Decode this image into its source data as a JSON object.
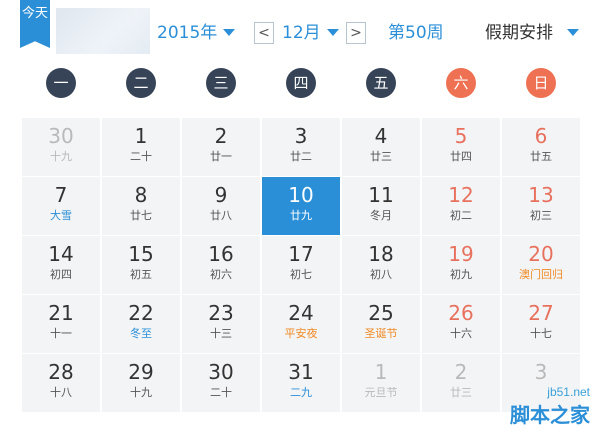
{
  "header": {
    "today_label": "今天",
    "year_label": "2015年",
    "prev_label": "<",
    "month_label": "12月",
    "next_label": ">",
    "week_label": "第50周",
    "holiday_label": "假期安排"
  },
  "weekdays": [
    "一",
    "二",
    "三",
    "四",
    "五",
    "六",
    "日"
  ],
  "weeks": [
    [
      {
        "day": "30",
        "sub": "十九",
        "dim": true
      },
      {
        "day": "1",
        "sub": "二十"
      },
      {
        "day": "2",
        "sub": "廿一"
      },
      {
        "day": "3",
        "sub": "廿二"
      },
      {
        "day": "4",
        "sub": "廿三"
      },
      {
        "day": "5",
        "sub": "廿四",
        "weekend": true
      },
      {
        "day": "6",
        "sub": "廿五",
        "weekend": true
      }
    ],
    [
      {
        "day": "7",
        "sub": "大雪",
        "sub_style": "blue"
      },
      {
        "day": "8",
        "sub": "廿七"
      },
      {
        "day": "9",
        "sub": "廿八"
      },
      {
        "day": "10",
        "sub": "廿九",
        "selected": true
      },
      {
        "day": "11",
        "sub": "冬月"
      },
      {
        "day": "12",
        "sub": "初二",
        "weekend": true
      },
      {
        "day": "13",
        "sub": "初三",
        "weekend": true
      }
    ],
    [
      {
        "day": "14",
        "sub": "初四"
      },
      {
        "day": "15",
        "sub": "初五"
      },
      {
        "day": "16",
        "sub": "初六"
      },
      {
        "day": "17",
        "sub": "初七"
      },
      {
        "day": "18",
        "sub": "初八"
      },
      {
        "day": "19",
        "sub": "初九",
        "weekend": true
      },
      {
        "day": "20",
        "sub": "澳门回归",
        "weekend": true,
        "sub_style": "orange"
      }
    ],
    [
      {
        "day": "21",
        "sub": "十一"
      },
      {
        "day": "22",
        "sub": "冬至",
        "sub_style": "blue"
      },
      {
        "day": "23",
        "sub": "十三"
      },
      {
        "day": "24",
        "sub": "平安夜",
        "sub_style": "orange"
      },
      {
        "day": "25",
        "sub": "圣诞节",
        "sub_style": "orange"
      },
      {
        "day": "26",
        "sub": "十六",
        "weekend": true
      },
      {
        "day": "27",
        "sub": "十七",
        "weekend": true
      }
    ],
    [
      {
        "day": "28",
        "sub": "十八"
      },
      {
        "day": "29",
        "sub": "十九"
      },
      {
        "day": "30",
        "sub": "二十"
      },
      {
        "day": "31",
        "sub": "二九",
        "sub_style": "blue"
      },
      {
        "day": "1",
        "sub": "元旦节",
        "dim": true
      },
      {
        "day": "2",
        "sub": "廿三",
        "dim": true
      },
      {
        "day": "3",
        "sub": "",
        "dim": true
      }
    ]
  ],
  "watermark": {
    "url": "jb51.net",
    "text": "脚本之家"
  },
  "colors": {
    "accent": "#2b8fd8",
    "weekday_circle": "#374458",
    "weekend_circle": "#ef7153",
    "weekend_number": "#e8715e",
    "festival": "#f08a24",
    "cell_background": "#f3f4f6"
  }
}
